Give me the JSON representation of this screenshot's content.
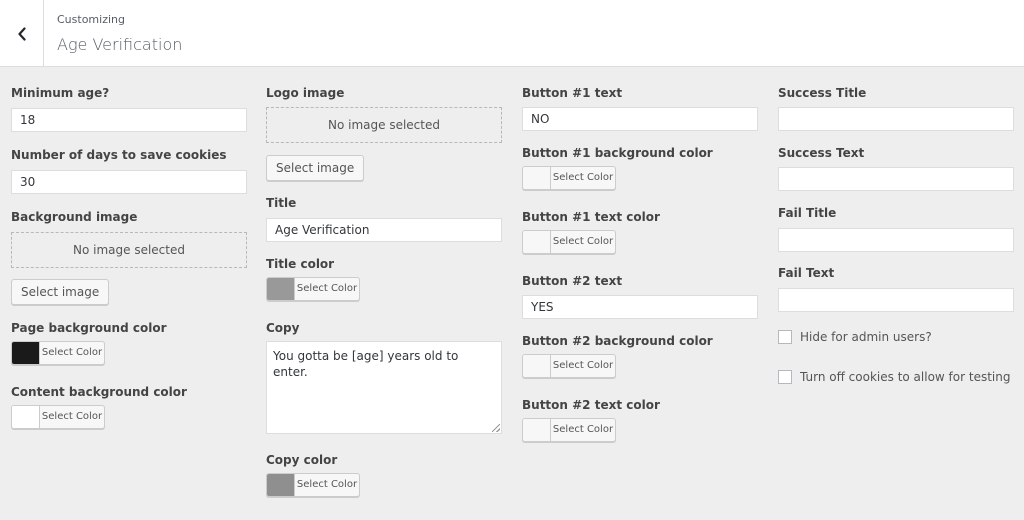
{
  "header": {
    "eyebrow": "Customizing",
    "title": "Age Verification",
    "back_icon": "chevron-left-icon"
  },
  "col1": {
    "min_age_label": "Minimum age?",
    "min_age_value": "18",
    "cookie_days_label": "Number of days to save cookies",
    "cookie_days_value": "30",
    "bg_image_label": "Background image",
    "bg_image_empty": "No image selected",
    "bg_image_button": "Select image",
    "page_bg_label": "Page background color",
    "page_bg_color": "#1a1a1a",
    "page_bg_button": "Select Color",
    "content_bg_label": "Content background color",
    "content_bg_color": "#ffffff",
    "content_bg_button": "Select Color"
  },
  "col2": {
    "logo_label": "Logo image",
    "logo_empty": "No image selected",
    "logo_button": "Select image",
    "title_label": "Title",
    "title_value": "Age Verification",
    "title_color_label": "Title color",
    "title_color": "#999999",
    "title_color_button": "Select Color",
    "copy_label": "Copy",
    "copy_value": "You gotta be [age] years old to enter.",
    "copy_color_label": "Copy color",
    "copy_color": "#8f8f8f",
    "copy_color_button": "Select Color"
  },
  "col3": {
    "btn1_text_label": "Button #1 text",
    "btn1_text_value": "NO",
    "btn1_bg_label": "Button #1 background color",
    "btn1_bg_color": "#f7f7f7",
    "btn1_bg_button": "Select Color",
    "btn1_textcolor_label": "Button #1 text color",
    "btn1_textcolor_color": "#f7f7f7",
    "btn1_textcolor_button": "Select Color",
    "btn2_text_label": "Button #2 text",
    "btn2_text_value": "YES",
    "btn2_bg_label": "Button #2 background color",
    "btn2_bg_color": "#f7f7f7",
    "btn2_bg_button": "Select Color",
    "btn2_textcolor_label": "Button #2 text color",
    "btn2_textcolor_color": "#f7f7f7",
    "btn2_textcolor_button": "Select Color"
  },
  "col4": {
    "success_title_label": "Success Title",
    "success_title_value": "",
    "success_text_label": "Success Text",
    "success_text_value": "",
    "fail_title_label": "Fail Title",
    "fail_title_value": "",
    "fail_text_label": "Fail Text",
    "fail_text_value": "",
    "hide_admin_label": "Hide for admin users?",
    "cookies_off_label": "Turn off cookies to allow for testing"
  }
}
